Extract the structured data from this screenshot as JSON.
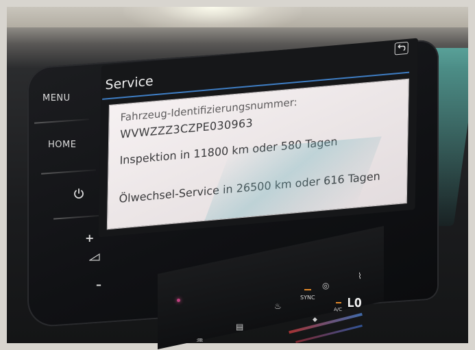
{
  "side_buttons": {
    "menu_label": "MENU",
    "home_label": "HOME",
    "power_icon": "power-icon",
    "volume_up_label": "+",
    "volume_icon": "volume-icon",
    "volume_down_label": "–"
  },
  "screen": {
    "title": "Service",
    "back_icon": "back-arrow-icon",
    "vin_label": "Fahrzeug-Identifizierungsnummer:",
    "vin_value": "WVWZZZ3CZPE030963",
    "inspection": "Inspektion in 11800 km oder 580 Tagen",
    "oil_service": "Ölwechsel-Service in 26500 km oder 616 Tagen"
  },
  "climate": {
    "sync_label": "SYNC",
    "ac_label": "A/C",
    "temperature": "LO",
    "led_color": "#e58a2a"
  },
  "colors": {
    "title_rule": "#3f7fc6",
    "panel_bg": "#f6f1f2"
  }
}
